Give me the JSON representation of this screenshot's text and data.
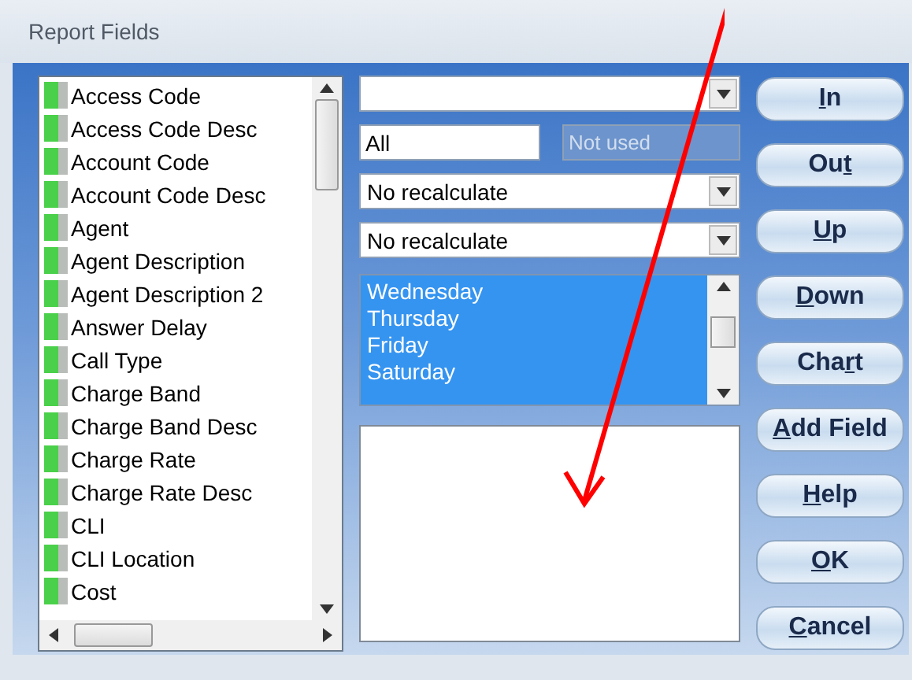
{
  "window": {
    "title": "Report Fields"
  },
  "fields": [
    {
      "label": "Access Code",
      "kind": "p"
    },
    {
      "label": "Access Code Desc",
      "kind": "p"
    },
    {
      "label": "Account Code",
      "kind": "p"
    },
    {
      "label": "Account Code Desc",
      "kind": "p"
    },
    {
      "label": "Agent",
      "kind": "p"
    },
    {
      "label": "Agent Description",
      "kind": "p"
    },
    {
      "label": "Agent Description 2",
      "kind": "p"
    },
    {
      "label": "Answer Delay",
      "kind": "p"
    },
    {
      "label": "Call Type",
      "kind": "p"
    },
    {
      "label": "Charge Band",
      "kind": "p"
    },
    {
      "label": "Charge Band Desc",
      "kind": "p"
    },
    {
      "label": "Charge Rate",
      "kind": "p"
    },
    {
      "label": "Charge Rate Desc",
      "kind": "p"
    },
    {
      "label": "CLI",
      "kind": "p"
    },
    {
      "label": "CLI Location",
      "kind": "p"
    },
    {
      "label": "Cost",
      "kind": "p"
    }
  ],
  "filter_field": {
    "value": "All"
  },
  "unused_field": {
    "value": "Not used",
    "disabled": true
  },
  "recalc_combos": [
    {
      "value": "No recalculate"
    },
    {
      "value": "No recalculate"
    }
  ],
  "days": [
    {
      "label": "Wednesday",
      "selected": true
    },
    {
      "label": "Thursday",
      "selected": true
    },
    {
      "label": "Friday",
      "selected": true
    },
    {
      "label": "Saturday",
      "selected": true
    }
  ],
  "buttons": [
    {
      "key": "I",
      "post": "n"
    },
    {
      "pre": "Ou",
      "key": "t"
    },
    {
      "key": "U",
      "post": "p"
    },
    {
      "key": "D",
      "post": "own"
    },
    {
      "pre": "Cha",
      "key": "r",
      "post": "t"
    },
    {
      "key": "A",
      "post": "dd Field"
    },
    {
      "key": "H",
      "post": "elp"
    },
    {
      "key": "O",
      "post": "K"
    },
    {
      "key": "C",
      "post": "ancel"
    }
  ],
  "annotation_arrow": true
}
